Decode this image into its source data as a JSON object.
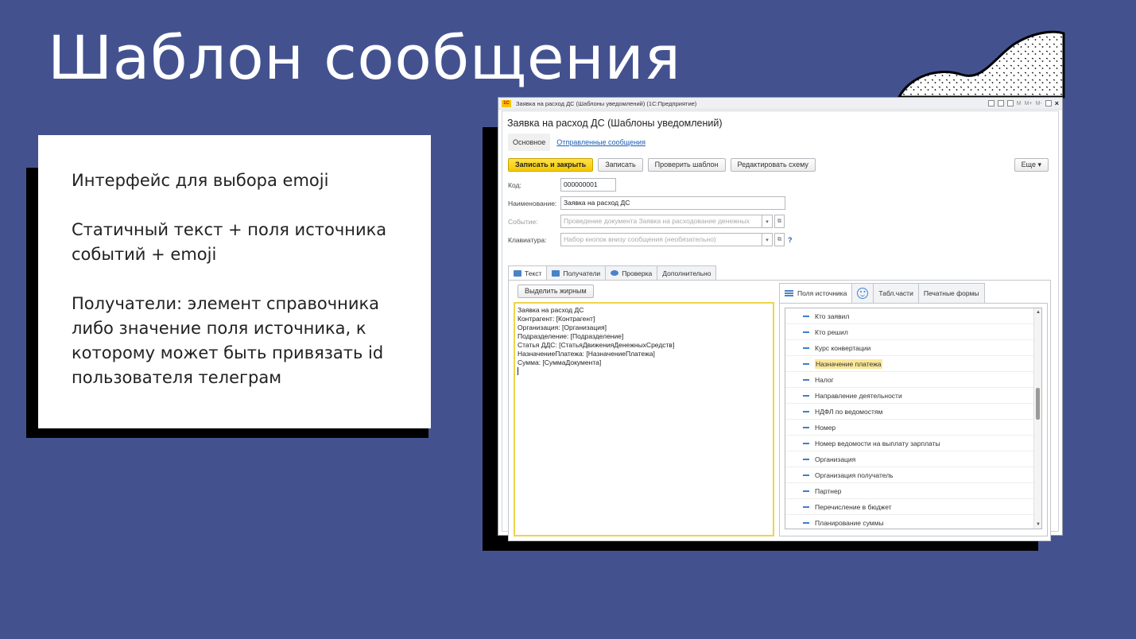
{
  "slide": {
    "title": "Шаблон сообщения",
    "bullets": [
      "Интерфейс для выбора emoji",
      "Статичный текст + поля источника событий + emoji",
      "Получатели: элемент справочника либо значение поля источника, к которому может быть привязать id пользователя телеграм"
    ]
  },
  "window": {
    "title": "Заявка на расход ДС (Шаблоны уведомлений)  (1С:Предприятие)",
    "logo": "1С",
    "controls": [
      "M",
      "M+",
      "M-"
    ],
    "close": "×"
  },
  "form": {
    "title": "Заявка на расход ДС (Шаблоны уведомлений)",
    "nav": {
      "main": "Основное",
      "sent": "Отправленные сообщения"
    },
    "toolbar": {
      "save_close": "Записать и закрыть",
      "save": "Записать",
      "check": "Проверить шаблон",
      "edit_scheme": "Редактировать схему",
      "more": "Еще ▾"
    },
    "fields": {
      "code_label": "Код:",
      "code_value": "000000001",
      "name_label": "Наименование:",
      "name_value": "Заявка на расход ДС",
      "event_label": "Событие:",
      "event_value": "Проведение документа Заявка на расходование денежных",
      "keyboard_label": "Клавиатура:",
      "keyboard_placeholder": "Набор кнопок внизу сообщения (необязательно)",
      "help": "?"
    },
    "tabs": [
      "Текст",
      "Получатели",
      "Проверка",
      "Дополнительно"
    ],
    "bold_button": "Выделить жирным",
    "editor_text": "Заявка на расход ДС\nКонтрагент: [Контрагент]\nОрганизация: [Организация]\nПодразделение: [Подразделение]\nСтатья ДДС: [СтатьяДвиженияДенежныхСредств]\nНазначениеПлатежа: [НазначениеПлатежа]\nСумма: [СуммаДокумента]",
    "right_tabs": {
      "fields": "Поля источника",
      "tables": "Табл.части",
      "print": "Печатные формы"
    },
    "source_fields": [
      "Кто заявил",
      "Кто решил",
      "Курс конвертации",
      "Назначение платежа",
      "Налог",
      "Направление деятельности",
      "НДФЛ по ведомостям",
      "Номер",
      "Номер ведомости на выплату зарплаты",
      "Организация",
      "Организация получатель",
      "Партнер",
      "Перечисление в бюджет",
      "Планирование суммы"
    ],
    "highlighted_field": "Назначение платежа"
  },
  "colors": {
    "background": "#43528f",
    "primary_button": "#f4c900",
    "highlight": "#fbe89a",
    "accent": "#3c7fd0"
  }
}
